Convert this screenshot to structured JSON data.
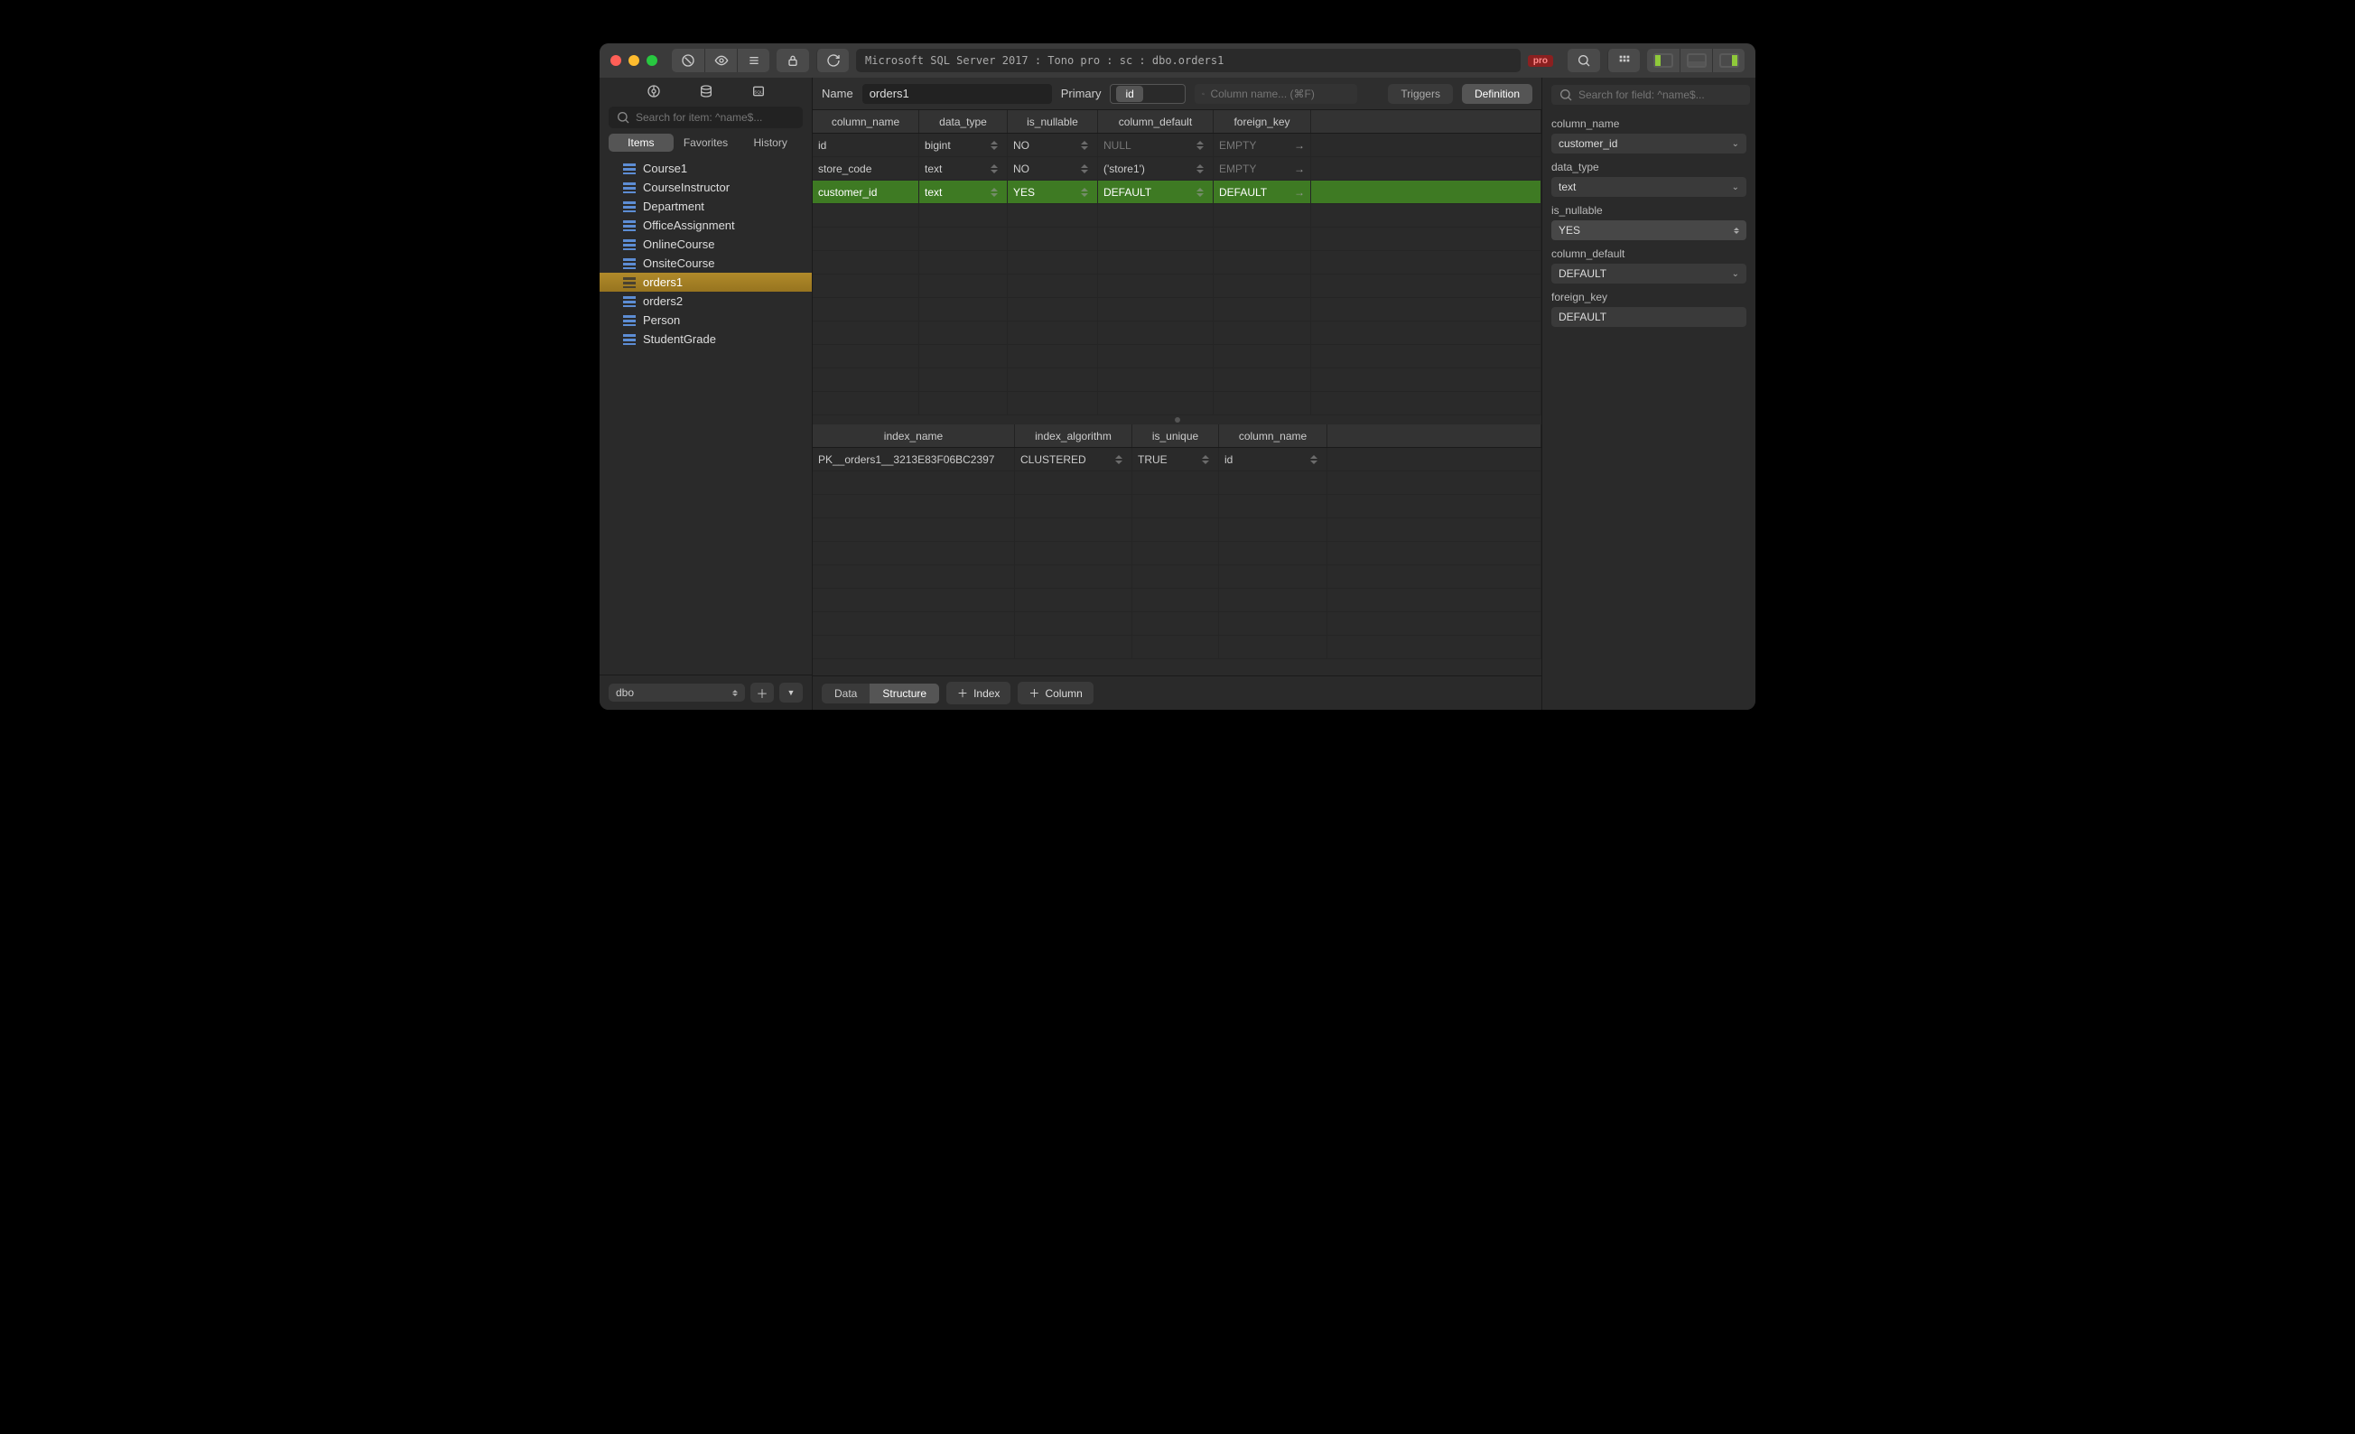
{
  "title_path": "Microsoft SQL Server 2017 : Tono pro : sc : dbo.orders1",
  "pro_badge": "pro",
  "name_label": "Name",
  "name_value": "orders1",
  "primary_label": "Primary",
  "primary_value": "id",
  "column_search_placeholder": "Column name... (⌘F)",
  "triggers_btn": "Triggers",
  "definition_btn": "Definition",
  "field_search_placeholder": "Search for field: ^name$...",
  "sidebar": {
    "search_placeholder": "Search for item: ^name$...",
    "tabs": [
      "Items",
      "Favorites",
      "History"
    ],
    "active_tab": 0,
    "items": [
      "Course1",
      "CourseInstructor",
      "Department",
      "OfficeAssignment",
      "OnlineCourse",
      "OnsiteCourse",
      "orders1",
      "orders2",
      "Person",
      "StudentGrade"
    ],
    "selected": "orders1",
    "schema": "dbo"
  },
  "columns": {
    "headers": [
      "column_name",
      "data_type",
      "is_nullable",
      "column_default",
      "foreign_key"
    ],
    "rows": [
      {
        "name": "id",
        "type": "bigint",
        "nullable": "NO",
        "default": "NULL",
        "fk": "EMPTY",
        "hl": false,
        "def_dim": true,
        "fk_dim": true
      },
      {
        "name": "store_code",
        "type": "text",
        "nullable": "NO",
        "default": "('store1')",
        "fk": "EMPTY",
        "hl": false,
        "def_dim": false,
        "fk_dim": true
      },
      {
        "name": "customer_id",
        "type": "text",
        "nullable": "YES",
        "default": "DEFAULT",
        "fk": "DEFAULT",
        "hl": true,
        "def_dim": false,
        "fk_dim": false
      }
    ]
  },
  "indexes": {
    "headers": [
      "index_name",
      "index_algorithm",
      "is_unique",
      "column_name"
    ],
    "rows": [
      {
        "name": "PK__orders1__3213E83F06BC2397",
        "alg": "CLUSTERED",
        "uniq": "TRUE",
        "col": "id"
      }
    ]
  },
  "footer": {
    "tabs": [
      "Data",
      "Structure"
    ],
    "active": 1,
    "add_index": "Index",
    "add_column": "Column"
  },
  "inspector": {
    "labels": {
      "column_name": "column_name",
      "data_type": "data_type",
      "is_nullable": "is_nullable",
      "column_default": "column_default",
      "foreign_key": "foreign_key"
    },
    "values": {
      "column_name": "customer_id",
      "data_type": "text",
      "is_nullable": "YES",
      "column_default": "DEFAULT",
      "foreign_key": "DEFAULT"
    }
  }
}
